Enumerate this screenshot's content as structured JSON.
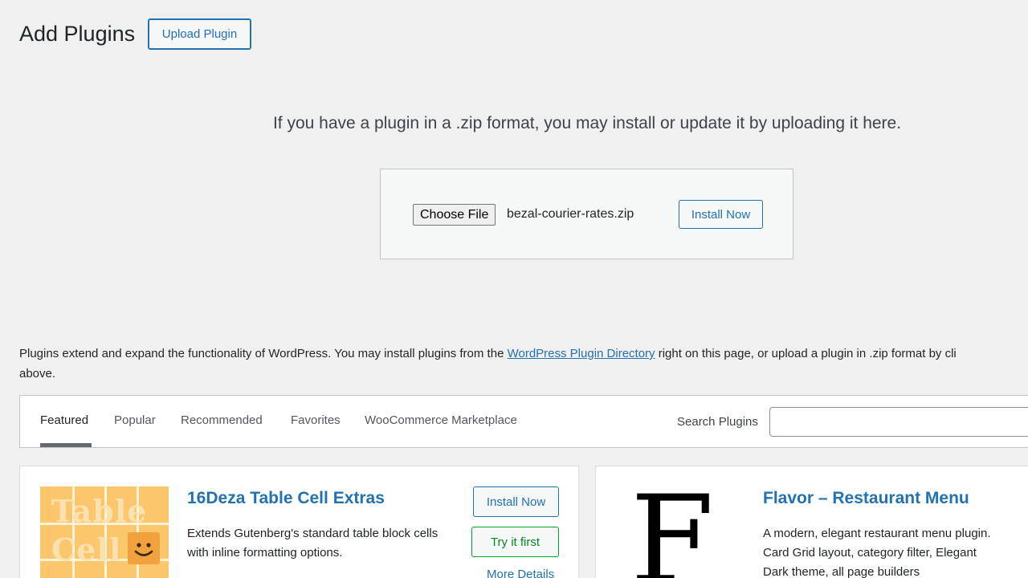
{
  "header": {
    "title": "Add Plugins",
    "upload_button": "Upload Plugin"
  },
  "upload": {
    "help_text": "If you have a plugin in a .zip format, you may install or update it by uploading it here.",
    "choose_file_label": "Choose File",
    "file_name": "bezal-courier-rates.zip",
    "install_button": "Install Now"
  },
  "description": {
    "before_link": "Plugins extend and expand the functionality of WordPress. You may install plugins from the ",
    "link_text": "WordPress Plugin Directory",
    "after_link": " right on this page, or upload a plugin in .zip format by cli",
    "second_line": "above."
  },
  "filter": {
    "tabs": [
      {
        "label": "Featured",
        "current": true
      },
      {
        "label": "Popular",
        "current": false
      },
      {
        "label": "Recommended",
        "current": false
      },
      {
        "label": "Favorites",
        "current": false
      },
      {
        "label": "WooCommerce Marketplace",
        "current": false
      }
    ],
    "search_label": "Search Plugins",
    "search_value": ""
  },
  "plugins": [
    {
      "name": "16Deza Table Cell Extras",
      "description": "Extends Gutenberg's standard table block cells with inline formatting options.",
      "install_label": "Install Now",
      "try_label": "Try it first",
      "more_label": "More Details",
      "thumb_words": [
        "Table",
        "Cell"
      ],
      "thumb_icon": "smiley-icon"
    },
    {
      "name": "Flavor – Restaurant Menu",
      "description": "A modern, elegant restaurant menu plugin. Card Grid layout, category filter, Elegant Dark theme, all page builders",
      "thumb_letter": "F"
    }
  ],
  "colors": {
    "accent": "#2271b1",
    "background": "#f0f0f1",
    "success": "#00a32a",
    "thumb_bg": "#fcc66c"
  }
}
